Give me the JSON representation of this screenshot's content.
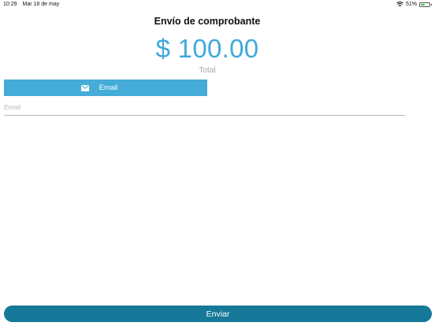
{
  "status_bar": {
    "time": "10:29",
    "date": "Mar 18 de may",
    "battery_percent": "51%",
    "battery_level": 0.51,
    "battery_color": "#34c759",
    "wifi_icon": "wifi-icon",
    "battery_icon": "battery-icon"
  },
  "header": {
    "title": "Envío de comprobante"
  },
  "summary": {
    "amount": "$ 100.00",
    "label": "Total"
  },
  "tabs": [
    {
      "label": "Email",
      "icon": "mail-icon",
      "selected": true
    }
  ],
  "form": {
    "email_placeholder": "Email",
    "email_value": ""
  },
  "actions": {
    "send_label": "Enviar"
  },
  "colors": {
    "accent": "#3fa9d9",
    "tab_background": "#45acd8",
    "button_background": "#17799a"
  }
}
